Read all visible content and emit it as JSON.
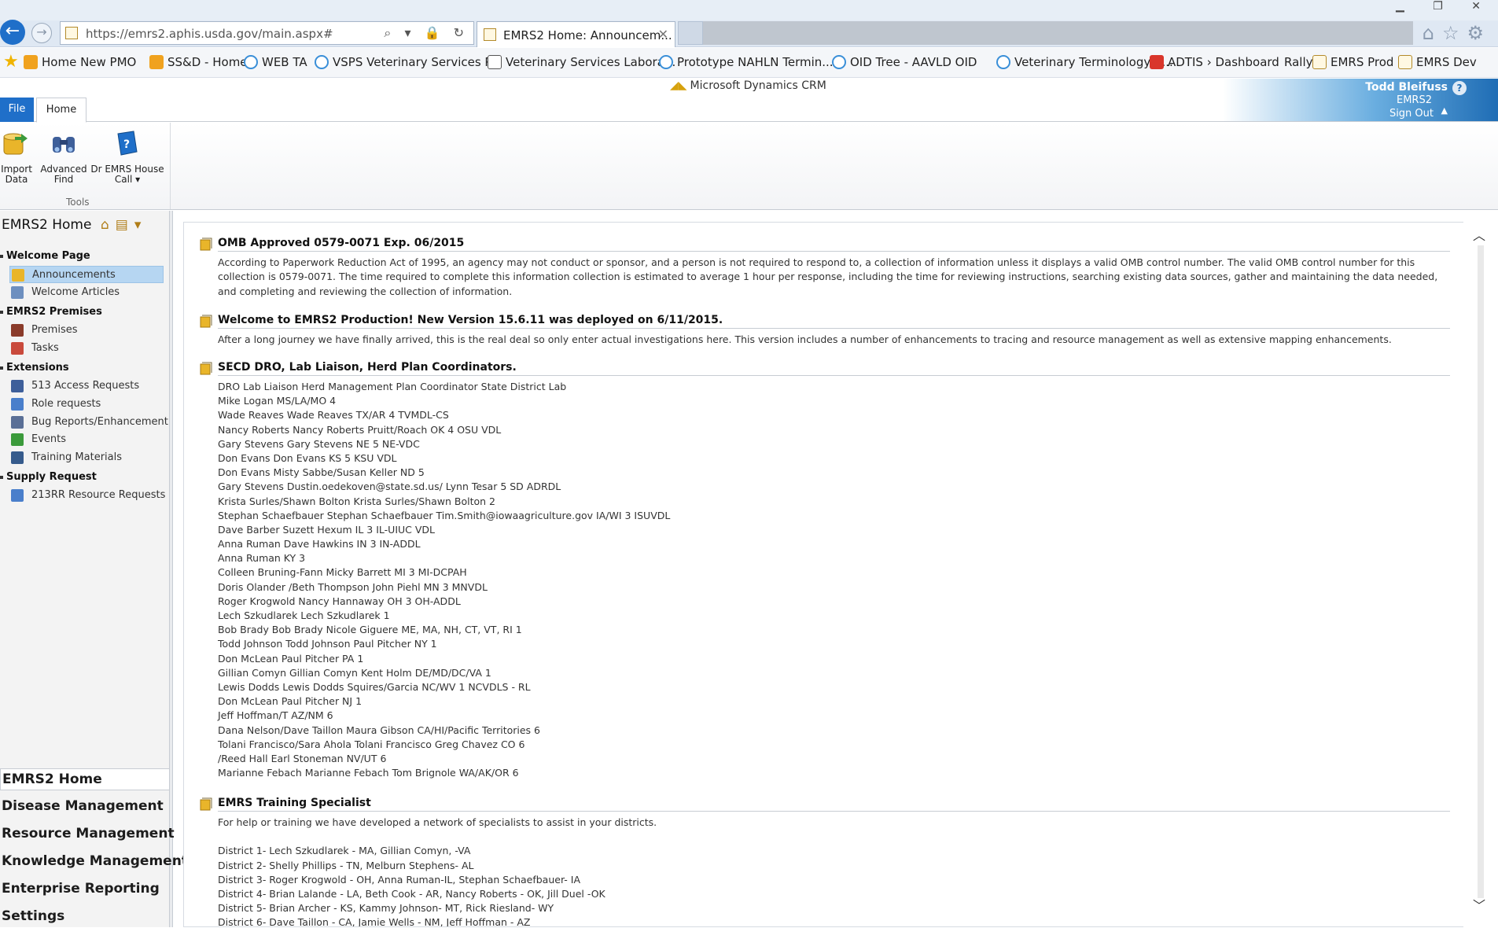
{
  "browser": {
    "url": "https://emrs2.aphis.usda.gov/main.aspx#",
    "tab_title": "EMRS2 Home: Announcem...",
    "favorites": [
      {
        "label": "Home New PMO",
        "icon": "orange"
      },
      {
        "label": "SS&D - Home",
        "icon": "orange"
      },
      {
        "label": "WEB TA",
        "icon": "ie"
      },
      {
        "label": "VSPS Veterinary Services P...",
        "icon": "ie"
      },
      {
        "label": "Veterinary Services Labora...",
        "icon": "doc"
      },
      {
        "label": "Prototype NAHLN Termin...",
        "icon": "ie"
      },
      {
        "label": "OID Tree - AAVLD OID",
        "icon": "ie"
      },
      {
        "label": "Veterinary Terminology S...",
        "icon": "ie"
      },
      {
        "label": "ADTIS › Dashboard",
        "icon": "red"
      },
      {
        "label": "Rally",
        "icon": "none"
      },
      {
        "label": "EMRS Prod",
        "icon": "crm"
      },
      {
        "label": "EMRS Dev",
        "icon": "crm"
      }
    ]
  },
  "crm": {
    "product": "Microsoft Dynamics CRM",
    "user_name": "Todd Bleifuss",
    "org": "EMRS2",
    "sign_out": "Sign Out",
    "help": "?"
  },
  "ribbon": {
    "tab_file": "File",
    "tab_home": "Home",
    "buttons": [
      {
        "label1": "Import",
        "label2": "Data"
      },
      {
        "label1": "Advanced",
        "label2": "Find"
      },
      {
        "label1": "Dr EMRS House",
        "label2": "Call ▾"
      }
    ],
    "group_label": "Tools"
  },
  "nav": {
    "title": "EMRS2 Home",
    "sections": [
      {
        "label": "Welcome Page",
        "items": [
          "Announcements",
          "Welcome Articles"
        ]
      },
      {
        "label": "EMRS2 Premises",
        "items": [
          "Premises",
          "Tasks"
        ]
      },
      {
        "label": "Extensions",
        "items": [
          "513 Access Requests",
          "Role requests",
          "Bug Reports/Enhancement",
          "Events",
          "Training Materials"
        ]
      },
      {
        "label": "Supply Request",
        "items": [
          "213RR Resource Requests"
        ]
      }
    ],
    "selected_item": "Announcements",
    "bottom": [
      "EMRS2 Home",
      "Disease Management",
      "Resource Management",
      "Knowledge Management",
      "Enterprise Reporting",
      "Settings"
    ]
  },
  "announcements": [
    {
      "title": "OMB Approved 0579-0071 Exp. 06/2015",
      "body": "According to Paperwork Reduction Act of 1995, an agency may not conduct or sponsor, and a person is not required to respond to, a collection of information unless it displays a valid OMB control number. The valid OMB control number for this collection is 0579-0071. The time required to complete this information collection is estimated to average 1 hour per response, including the time for reviewing instructions, searching existing data sources, gather and maintaining the data needed, and completing and reviewing the collection of information."
    },
    {
      "title": "Welcome to EMRS2 Production! New Version 15.6.11 was deployed on 6/11/2015.",
      "body": "After a long journey we have finally arrived, this is the real deal so only enter actual investigations here. This version includes a number of enhancements to tracing and resource management as well as extensive mapping enhancements."
    },
    {
      "title": "SECD DRO, Lab Liaison, Herd Plan Coordinators.",
      "lines": [
        "DRO Lab Liaison Herd Management Plan Coordinator State District Lab",
        "Mike Logan MS/LA/MO 4",
        "Wade Reaves Wade Reaves TX/AR 4 TVMDL-CS",
        "Nancy Roberts Nancy Roberts Pruitt/Roach OK 4 OSU VDL",
        "Gary Stevens Gary Stevens NE 5 NE-VDC",
        "Don Evans Don Evans KS 5 KSU VDL",
        "Don Evans Misty Sabbe/Susan Keller ND 5",
        "Gary Stevens Dustin.oedekoven@state.sd.us/ Lynn Tesar 5 SD ADRDL",
        "Krista Surles/Shawn Bolton Krista Surles/Shawn Bolton 2",
        "Stephan Schaefbauer Stephan Schaefbauer Tim.Smith@iowaagriculture.gov IA/WI 3 ISUVDL",
        "Dave Barber Suzett Hexum IL 3 IL-UIUC VDL",
        "Anna Ruman Dave Hawkins IN 3 IN-ADDL",
        "Anna Ruman KY 3",
        "Colleen Bruning-Fann Micky Barrett MI 3 MI-DCPAH",
        "Doris Olander /Beth Thompson John Piehl MN 3 MNVDL",
        "Roger Krogwold Nancy Hannaway OH 3 OH-ADDL",
        "Lech Szkudlarek Lech Szkudlarek 1",
        "Bob Brady Bob Brady Nicole Giguere ME, MA, NH, CT, VT, RI 1",
        "Todd Johnson Todd Johnson Paul Pitcher NY 1",
        "Don McLean Paul Pitcher PA 1",
        "Gillian Comyn Gillian Comyn Kent Holm DE/MD/DC/VA 1",
        "Lewis Dodds Lewis Dodds Squires/Garcia NC/WV 1 NCVDLS - RL",
        "Don McLean Paul Pitcher NJ 1",
        "Jeff Hoffman/T AZ/NM 6",
        "Dana Nelson/Dave Taillon Maura Gibson CA/HI/Pacific Territories 6",
        "Tolani Francisco/Sara Ahola Tolani Francisco Greg Chavez CO 6",
        "/Reed Hall Earl Stoneman NV/UT 6",
        "Marianne Febach Marianne Febach Tom Brignole WA/AK/OR 6"
      ]
    },
    {
      "title": "EMRS Training Specialist",
      "lines": [
        "For help or training we have developed a network of specialists to assist in your districts.",
        "",
        "District 1- Lech Szkudlarek - MA, Gillian Comyn, -VA",
        "District 2- Shelly Phillips - TN, Melburn Stephens- AL",
        "District 3- Roger Krogwold - OH, Anna Ruman-IL, Stephan Schaefbauer- IA",
        "District 4- Brian Lalande - LA, Beth Cook - AR, Nancy Roberts - OK, Jill Duel -OK",
        "District 5- Brian Archer - KS, Kammy Johnson- MT, Rick Riesland- WY",
        "District 6- Dave Taillon - CA, Jamie Wells - NM, Jeff Hoffman - AZ"
      ]
    }
  ]
}
